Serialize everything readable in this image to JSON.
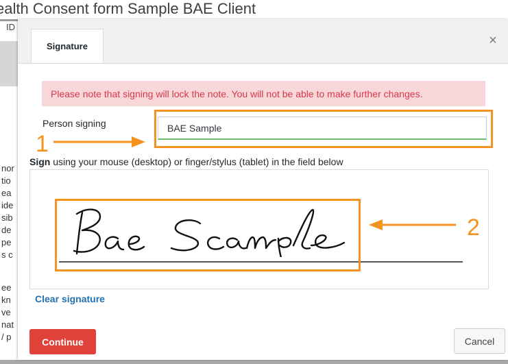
{
  "background": {
    "title": "ealth Consent form Sample BAE Client",
    "id_label": "ID",
    "fragments": [
      "nor",
      "tio",
      "ea",
      "ide",
      "sib",
      "de",
      "pe",
      "s c",
      "ee",
      "kn",
      "ve",
      "nat",
      "/ p"
    ]
  },
  "modal": {
    "tab_label": "Signature",
    "close_icon": "×",
    "notice": "Please note that signing will lock the note. You will not be able to make further changes.",
    "person_signing_label": "Person signing",
    "person_signing_value": "BAE Sample",
    "sign_instruction_bold": "Sign",
    "sign_instruction_rest": " using your mouse (desktop) or finger/stylus (tablet) in the field below",
    "signature_text": "Bae Sample",
    "clear_signature_label": "Clear signature",
    "continue_label": "Continue",
    "cancel_label": "Cancel"
  },
  "annotations": {
    "marker_1": "1",
    "marker_2": "2",
    "color": "#f6921e"
  },
  "colors": {
    "notice_bg": "#f8d7da",
    "notice_text": "#d6394a",
    "continue_bg": "#e0423a",
    "link": "#2271b1"
  }
}
